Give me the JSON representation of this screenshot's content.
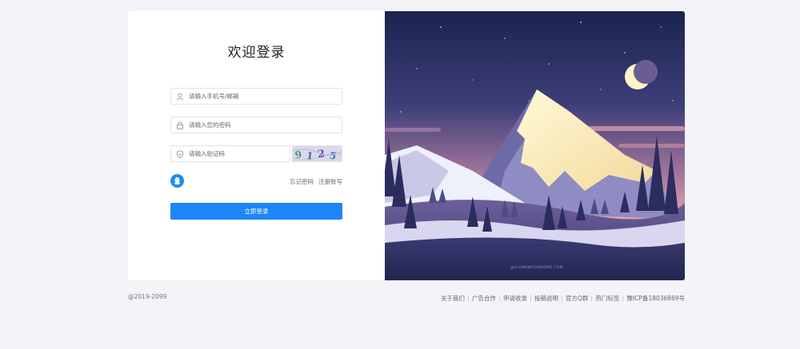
{
  "login": {
    "title": "欢迎登录",
    "username_placeholder": "请输入手机号/邮箱",
    "password_placeholder": "请输入您的密码",
    "captcha_placeholder": "请输入验证码",
    "captcha_text": "9 1 2 5",
    "forgot_password": "忘记密码",
    "register": "注册账号",
    "submit": "立即登录"
  },
  "illustration": {
    "watermark": "@ILLUMINATEDHOME.COM"
  },
  "footer": {
    "copyright": "@2019-2099",
    "links": [
      "关于我们",
      "广告合作",
      "申请收录",
      "投稿说明",
      "官方Q群",
      "热门标签",
      "豫ICP备18036869号"
    ]
  },
  "colors": {
    "page_bg": "#f2f4f8",
    "primary": "#1e85f8",
    "qq": "#1e8cf0"
  }
}
